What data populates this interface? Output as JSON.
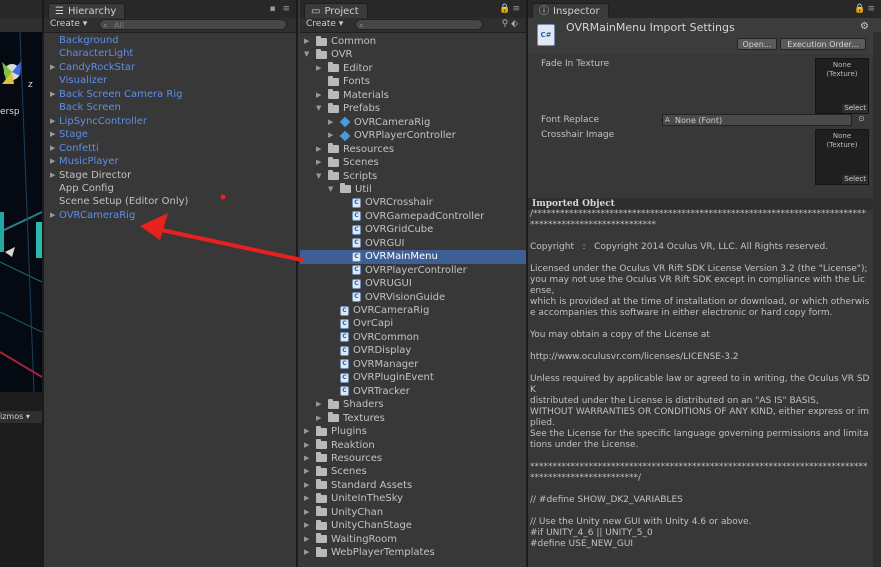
{
  "hierarchy": {
    "tab": "Hierarchy",
    "create": "Create",
    "search_placeholder": "All",
    "items": [
      {
        "label": "Background",
        "color": "blue",
        "expandable": false
      },
      {
        "label": "CharacterLight",
        "color": "blue",
        "expandable": false
      },
      {
        "label": "CandyRockStar",
        "color": "blue",
        "expandable": true
      },
      {
        "label": "Visualizer",
        "color": "blue",
        "expandable": false
      },
      {
        "label": "Back Screen Camera Rig",
        "color": "blue",
        "expandable": true
      },
      {
        "label": "Back Screen",
        "color": "blue",
        "expandable": false
      },
      {
        "label": "LipSyncController",
        "color": "blue",
        "expandable": true
      },
      {
        "label": "Stage",
        "color": "blue",
        "expandable": true
      },
      {
        "label": "Confetti",
        "color": "blue",
        "expandable": true
      },
      {
        "label": "MusicPlayer",
        "color": "blue",
        "expandable": true
      },
      {
        "label": "Stage Director",
        "color": "grey",
        "expandable": true
      },
      {
        "label": "App Config",
        "color": "grey",
        "expandable": false
      },
      {
        "label": "Scene Setup (Editor Only)",
        "color": "grey",
        "expandable": false
      },
      {
        "label": "OVRCameraRig",
        "color": "blue",
        "expandable": true
      }
    ]
  },
  "scene": {
    "persp_label": "ersp",
    "gizmos_label": "izmos",
    "axis_z": "z"
  },
  "project": {
    "tab": "Project",
    "create": "Create",
    "items": [
      {
        "label": "Common",
        "type": "folder",
        "depth": 0,
        "arrow": "▶"
      },
      {
        "label": "OVR",
        "type": "folder",
        "depth": 0,
        "arrow": "▼"
      },
      {
        "label": "Editor",
        "type": "folder",
        "depth": 1,
        "arrow": "▶"
      },
      {
        "label": "Fonts",
        "type": "folder",
        "depth": 1,
        "arrow": ""
      },
      {
        "label": "Materials",
        "type": "folder",
        "depth": 1,
        "arrow": "▶"
      },
      {
        "label": "Prefabs",
        "type": "folder",
        "depth": 1,
        "arrow": "▼"
      },
      {
        "label": "OVRCameraRig",
        "type": "prefab",
        "depth": 2,
        "arrow": "▶"
      },
      {
        "label": "OVRPlayerController",
        "type": "prefab",
        "depth": 2,
        "arrow": "▶"
      },
      {
        "label": "Resources",
        "type": "folder",
        "depth": 1,
        "arrow": "▶"
      },
      {
        "label": "Scenes",
        "type": "folder",
        "depth": 1,
        "arrow": "▶"
      },
      {
        "label": "Scripts",
        "type": "folder",
        "depth": 1,
        "arrow": "▼"
      },
      {
        "label": "Util",
        "type": "folder",
        "depth": 2,
        "arrow": "▼"
      },
      {
        "label": "OVRCrosshair",
        "type": "script",
        "depth": 3,
        "arrow": ""
      },
      {
        "label": "OVRGamepadController",
        "type": "script",
        "depth": 3,
        "arrow": ""
      },
      {
        "label": "OVRGridCube",
        "type": "script",
        "depth": 3,
        "arrow": ""
      },
      {
        "label": "OVRGUI",
        "type": "script",
        "depth": 3,
        "arrow": ""
      },
      {
        "label": "OVRMainMenu",
        "type": "script",
        "depth": 3,
        "arrow": "",
        "selected": true
      },
      {
        "label": "OVRPlayerController",
        "type": "script",
        "depth": 3,
        "arrow": ""
      },
      {
        "label": "OVRUGUI",
        "type": "script",
        "depth": 3,
        "arrow": ""
      },
      {
        "label": "OVRVisionGuide",
        "type": "script",
        "depth": 3,
        "arrow": ""
      },
      {
        "label": "OVRCameraRig",
        "type": "script",
        "depth": 2,
        "arrow": ""
      },
      {
        "label": "OvrCapi",
        "type": "script",
        "depth": 2,
        "arrow": ""
      },
      {
        "label": "OVRCommon",
        "type": "script",
        "depth": 2,
        "arrow": ""
      },
      {
        "label": "OVRDisplay",
        "type": "script",
        "depth": 2,
        "arrow": ""
      },
      {
        "label": "OVRManager",
        "type": "script",
        "depth": 2,
        "arrow": ""
      },
      {
        "label": "OVRPluginEvent",
        "type": "script",
        "depth": 2,
        "arrow": ""
      },
      {
        "label": "OVRTracker",
        "type": "script",
        "depth": 2,
        "arrow": ""
      },
      {
        "label": "Shaders",
        "type": "folder",
        "depth": 1,
        "arrow": "▶"
      },
      {
        "label": "Textures",
        "type": "folder",
        "depth": 1,
        "arrow": "▶"
      },
      {
        "label": "Plugins",
        "type": "folder",
        "depth": 0,
        "arrow": "▶"
      },
      {
        "label": "Reaktion",
        "type": "folder",
        "depth": 0,
        "arrow": "▶"
      },
      {
        "label": "Resources",
        "type": "folder",
        "depth": 0,
        "arrow": "▶"
      },
      {
        "label": "Scenes",
        "type": "folder",
        "depth": 0,
        "arrow": "▶"
      },
      {
        "label": "Standard Assets",
        "type": "folder",
        "depth": 0,
        "arrow": "▶"
      },
      {
        "label": "UniteInTheSky",
        "type": "folder",
        "depth": 0,
        "arrow": "▶"
      },
      {
        "label": "UnityChan",
        "type": "folder",
        "depth": 0,
        "arrow": "▶"
      },
      {
        "label": "UnityChanStage",
        "type": "folder",
        "depth": 0,
        "arrow": "▶"
      },
      {
        "label": "WaitingRoom",
        "type": "folder",
        "depth": 0,
        "arrow": "▶"
      },
      {
        "label": "WebPlayerTemplates",
        "type": "folder",
        "depth": 0,
        "arrow": "▶"
      }
    ]
  },
  "inspector": {
    "tab": "Inspector",
    "title": "OVRMainMenu Import Settings",
    "icon_text": "C#",
    "open_button": "Open...",
    "exec_order_button": "Execution Order...",
    "fade_label": "Fade In Texture",
    "fade_value": "None\n(Texture)",
    "fade_select": "Select",
    "font_label": "Font Replace",
    "font_value": "None (Font)",
    "crosshair_label": "Crosshair Image",
    "crosshair_value": "None\n(Texture)",
    "crosshair_select": "Select",
    "imported_header": "Imported Object",
    "code": "/******************************************************************************************************\n\nCopyright   :   Copyright 2014 Oculus VR, LLC. All Rights reserved.\n\nLicensed under the Oculus VR Rift SDK License Version 3.2 (the \"License\");\nyou may not use the Oculus VR Rift SDK except in compliance with the License,\nwhich is provided at the time of installation or download, or which otherwise accompanies this software in either electronic or hard copy form.\n\nYou may obtain a copy of the License at\n\nhttp://www.oculusvr.com/licenses/LICENSE-3.2\n\nUnless required by applicable law or agreed to in writing, the Oculus VR SDK\ndistributed under the License is distributed on an \"AS IS\" BASIS,\nWITHOUT WARRANTIES OR CONDITIONS OF ANY KIND, either express or implied.\nSee the License for the specific language governing permissions and limitations under the License.\n\n***************************************************************************************************/\n\n// #define SHOW_DK2_VARIABLES\n\n// Use the Unity new GUI with Unity 4.6 or above.\n#if UNITY_4_6 || UNITY_5_0\n#define USE_NEW_GUI"
  },
  "colors": {
    "accent_blue": "#5d8ee9",
    "selection": "#3e5f96",
    "annotation_red": "#e8211f"
  }
}
